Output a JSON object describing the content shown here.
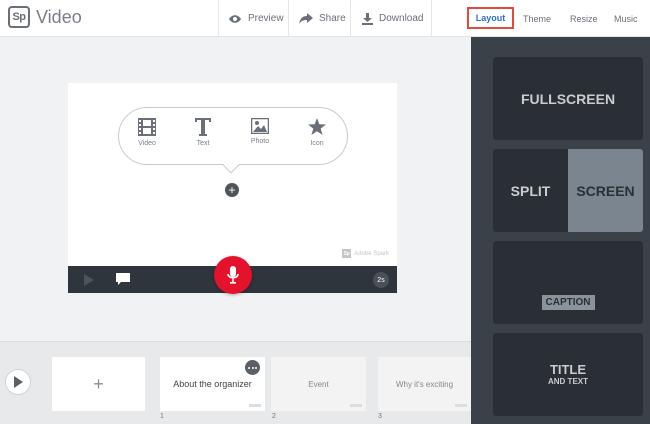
{
  "app": {
    "logo": "Sp",
    "title": "Video"
  },
  "toolbar": {
    "preview": "Preview",
    "share": "Share",
    "download": "Download"
  },
  "tabs": {
    "layout": "Layout",
    "theme": "Theme",
    "resize": "Resize",
    "music": "Music"
  },
  "layouts": {
    "fullscreen": "FULLSCREEN",
    "split_left": "SPLIT",
    "split_right": "SCREEN",
    "caption": "CAPTION",
    "title": "TITLE",
    "title_sub": "AND TEXT"
  },
  "canvas": {
    "options": [
      "Video",
      "Text",
      "Photo",
      "Icon"
    ],
    "add": "+",
    "watermark_logo": "Sp",
    "watermark": "Adobe Spark",
    "duration": "2s"
  },
  "strip": {
    "add": "+",
    "slides": [
      {
        "label": "About the organizer",
        "num": "1"
      },
      {
        "label": "Event",
        "num": "2"
      },
      {
        "label": "Why it's exciting",
        "num": "3"
      }
    ]
  },
  "colors": {
    "accent": "#2c6fd6",
    "highlight": "#e24a3b",
    "mic": "#e4122c",
    "panel": "#3b4148"
  }
}
